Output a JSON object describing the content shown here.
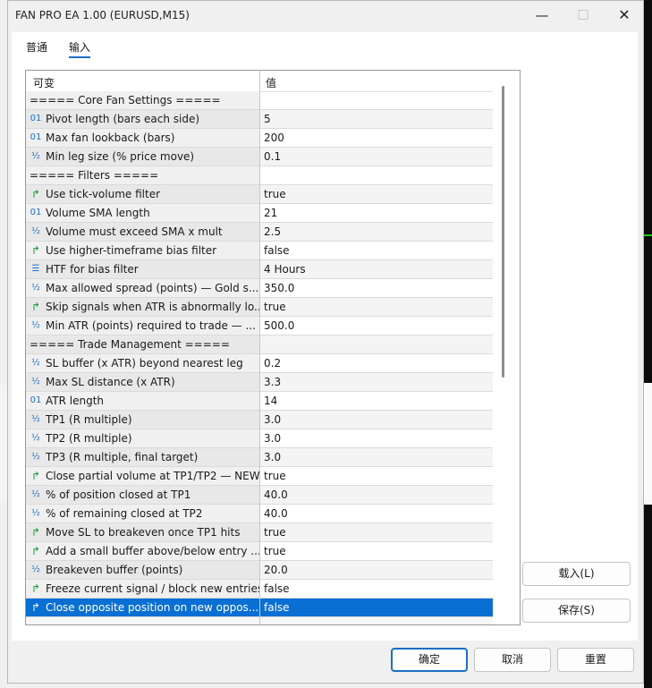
{
  "window": {
    "title": "FAN PRO EA 1.00 (EURUSD,M15)",
    "minimize_glyph": "—",
    "maximize_glyph": "☐",
    "close_glyph": "✕"
  },
  "tabs": [
    {
      "label": "普通",
      "active": false
    },
    {
      "label": "输入",
      "active": true
    }
  ],
  "grid": {
    "col_variable": "可变",
    "col_value": "值",
    "rows": [
      {
        "icon": "",
        "name": "===== Core Fan Settings =====",
        "value": ""
      },
      {
        "icon": "01",
        "name": "Pivot length (bars each side)",
        "value": "5"
      },
      {
        "icon": "01",
        "name": "Max fan lookback (bars)",
        "value": "200"
      },
      {
        "icon": "½",
        "name": "Min leg size (% price move)",
        "value": "0.1"
      },
      {
        "icon": "",
        "name": "===== Filters =====",
        "value": ""
      },
      {
        "icon": "↱",
        "name": "Use tick-volume filter",
        "value": "true"
      },
      {
        "icon": "01",
        "name": "Volume SMA length",
        "value": "21"
      },
      {
        "icon": "½",
        "name": "Volume must exceed SMA x mult",
        "value": "2.5"
      },
      {
        "icon": "↱",
        "name": "Use higher-timeframe bias filter",
        "value": "false"
      },
      {
        "icon": "☰",
        "name": "HTF for bias filter",
        "value": "4 Hours"
      },
      {
        "icon": "½",
        "name": "Max allowed spread (points) — Gold s...",
        "value": "350.0"
      },
      {
        "icon": "↱",
        "name": "Skip signals when ATR is abnormally lo...",
        "value": "true"
      },
      {
        "icon": "½",
        "name": "Min ATR (points) required to trade — ...",
        "value": "500.0"
      },
      {
        "icon": "",
        "name": "===== Trade Management =====",
        "value": ""
      },
      {
        "icon": "½",
        "name": "SL buffer (x ATR) beyond nearest leg",
        "value": "0.2"
      },
      {
        "icon": "½",
        "name": "Max SL distance (x ATR)",
        "value": "3.3"
      },
      {
        "icon": "01",
        "name": "ATR length",
        "value": "14"
      },
      {
        "icon": "½",
        "name": "TP1 (R multiple)",
        "value": "3.0"
      },
      {
        "icon": "½",
        "name": "TP2 (R multiple)",
        "value": "3.0"
      },
      {
        "icon": "½",
        "name": "TP3 (R multiple, final target)",
        "value": "3.0"
      },
      {
        "icon": "↱",
        "name": "Close partial volume at TP1/TP2 — NEW",
        "value": "true"
      },
      {
        "icon": "½",
        "name": "% of position closed at TP1",
        "value": "40.0"
      },
      {
        "icon": "½",
        "name": "% of remaining closed at TP2",
        "value": "40.0"
      },
      {
        "icon": "↱",
        "name": "Move SL to breakeven once TP1 hits",
        "value": "true"
      },
      {
        "icon": "↱",
        "name": "Add a small buffer above/below entry ...",
        "value": "true"
      },
      {
        "icon": "½",
        "name": "Breakeven buffer (points)",
        "value": "20.0"
      },
      {
        "icon": "↱",
        "name": "Freeze current signal / block new entries",
        "value": "false"
      },
      {
        "icon": "↱",
        "name": "Close opposite position on new oppos...",
        "value": "false",
        "selected": true
      }
    ]
  },
  "side_buttons": {
    "load": "载入(L)",
    "save": "保存(S)"
  },
  "footer_buttons": {
    "ok": "确定",
    "cancel": "取消",
    "reset": "重置"
  }
}
